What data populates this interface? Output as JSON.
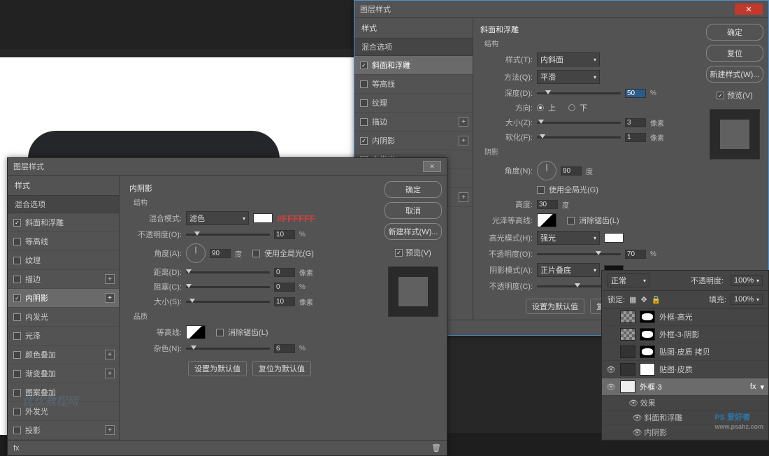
{
  "dialog_title": "图层样式",
  "styles_header": "样式",
  "mix_options": "混合选项",
  "style_items": {
    "bevel": "斜面和浮雕",
    "contour": "等高线",
    "texture": "纹理",
    "stroke": "描边",
    "inner_shadow": "内阴影",
    "inner_glow": "内发光",
    "satin": "光泽",
    "color_overlay": "颜色叠加",
    "grad_overlay": "渐变叠加",
    "pat_overlay": "图案叠加",
    "outer_glow": "外发光",
    "drop_shadow": "投影"
  },
  "btns": {
    "ok": "确定",
    "cancel": "取消",
    "reset": "复位",
    "new_style": "新建样式(W)...",
    "preview": "预览(V)"
  },
  "inner_shadow": {
    "title": "内阴影",
    "struct": "结构",
    "blend_mode_lbl": "混合模式:",
    "blend_mode_val": "滤色",
    "color_hex": "#FFFFFF",
    "opacity_lbl": "不透明度(O):",
    "opacity_val": "10",
    "angle_lbl": "角度(A):",
    "angle_val": "90",
    "deg": "度",
    "global_light": "使用全局光(G)",
    "distance_lbl": "距离(D):",
    "distance_val": "0",
    "px": "像素",
    "choke_lbl": "阻塞(C):",
    "choke_val": "0",
    "size_lbl": "大小(S):",
    "size_val": "10",
    "quality": "品质",
    "contour_lbl": "等高线:",
    "antialias": "消除锯齿(L)",
    "noise_lbl": "杂色(N):",
    "noise_val": "6",
    "pct": "%",
    "set_default": "设置为默认值",
    "reset_default": "复位为默认值"
  },
  "bevel": {
    "title": "斜面和浮雕",
    "struct": "结构",
    "style_lbl": "样式(T):",
    "style_val": "内斜面",
    "tech_lbl": "方法(Q):",
    "tech_val": "平滑",
    "depth_lbl": "深度(D):",
    "depth_val": "50",
    "dir_lbl": "方向:",
    "dir_up": "上",
    "dir_down": "下",
    "size_lbl": "大小(Z):",
    "size_val": "3",
    "soften_lbl": "软化(F):",
    "soften_val": "1",
    "shading": "阴影",
    "angle_lbl": "角度(N):",
    "angle_val": "90",
    "global_light": "使用全局光(G)",
    "altitude_lbl": "高度:",
    "altitude_val": "30",
    "gloss_lbl": "光泽等高线:",
    "antialias": "消除锯齿(L)",
    "hl_mode_lbl": "高光模式(H):",
    "hl_mode_val": "强光",
    "hl_opacity_lbl": "不透明度(O):",
    "hl_opacity_val": "70",
    "sh_mode_lbl": "阴影模式(A):",
    "sh_mode_val": "正片叠底",
    "sh_opacity_lbl": "不透明度(C):",
    "sh_opacity_val": "45",
    "px": "像素",
    "pct": "%",
    "deg": "度",
    "set_default": "设置为默认值",
    "reset_default": "复位为默认值"
  },
  "layers": {
    "blend": "正常",
    "opacity_lbl": "不透明度:",
    "opacity_val": "100%",
    "lock_lbl": "锁定:",
    "fill_lbl": "填充:",
    "fill_val": "100%",
    "l1": "外框·高光",
    "l2": "外框-3·阴影",
    "l3": "贴图·皮质 拷贝",
    "l4": "贴图·皮质",
    "l5": "外框·3",
    "fx": "效果",
    "fx1": "斜面和浮雕",
    "fx2": "内阴影",
    "fx_badge": "fx"
  },
  "footer_fx": "fx",
  "watermark1": "优优教程网",
  "watermark2": "PS 爱好者",
  "watermark2_sub": "www.psahz.com"
}
